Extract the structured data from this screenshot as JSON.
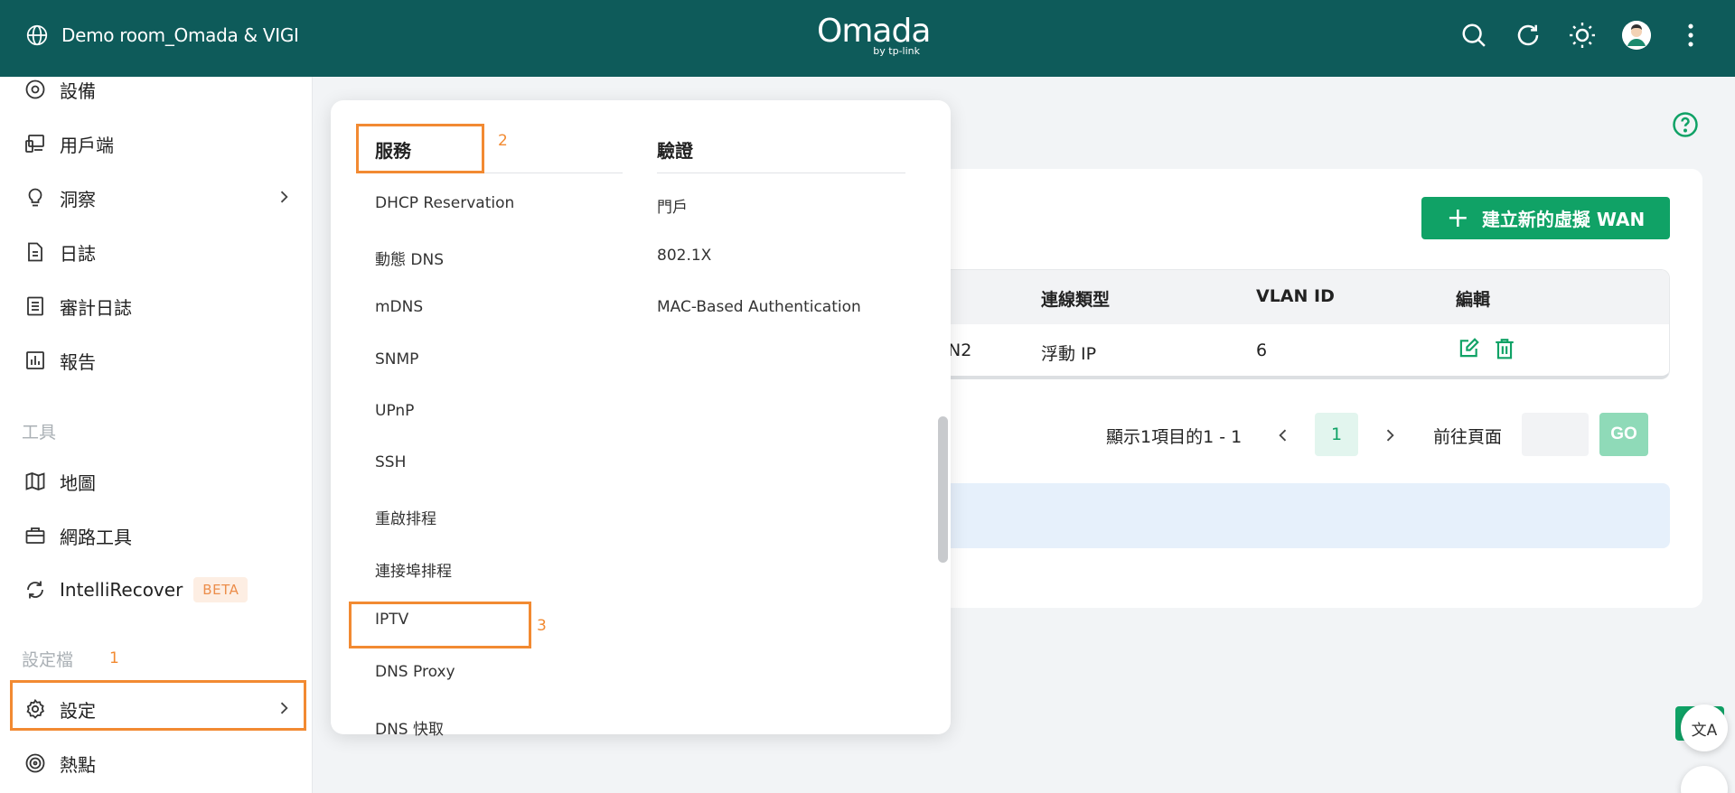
{
  "header": {
    "site_name": "Demo room_Omada & VIGI",
    "brand": "Omada",
    "brand_sub": "by tp-link",
    "icons": [
      "search-icon",
      "refresh-icon",
      "theme-icon",
      "avatar",
      "more-icon"
    ]
  },
  "sidebar": {
    "items": [
      {
        "label": "設備",
        "icon": "devices-icon"
      },
      {
        "label": "用戶端",
        "icon": "clients-icon"
      },
      {
        "label": "洞察",
        "icon": "insight-icon"
      },
      {
        "label": "日誌",
        "icon": "log-icon"
      },
      {
        "label": "審計日誌",
        "icon": "audit-log-icon"
      },
      {
        "label": "報告",
        "icon": "report-icon"
      }
    ],
    "tools_section": "工具",
    "tools": [
      {
        "label": "地圖",
        "icon": "map-icon"
      },
      {
        "label": "網路工具",
        "icon": "network-tools-icon"
      },
      {
        "label": "IntelliRecover",
        "icon": "intellirecover-icon",
        "badge": "BETA"
      }
    ],
    "profile_section": "設定檔",
    "profile": [
      {
        "label": "設定",
        "icon": "gear-icon"
      },
      {
        "label": "熱點",
        "icon": "hotspot-icon"
      }
    ]
  },
  "annotations": {
    "a1": "1",
    "a2": "2",
    "a3": "3"
  },
  "menu": {
    "services_title": "服務",
    "services": [
      "DHCP Reservation",
      "動態 DNS",
      "mDNS",
      "SNMP",
      "UPnP",
      "SSH",
      "重啟排程",
      "連接埠排程",
      "IPTV",
      "DNS Proxy",
      "DNS 快取"
    ],
    "auth_title": "驗證",
    "auth": [
      "門戶",
      "802.1X",
      "MAC-Based Authentication"
    ]
  },
  "main": {
    "add_button": "建立新的虛擬 WAN",
    "table": {
      "headers": [
        "連線類型",
        "VLAN ID",
        "編輯"
      ],
      "row": {
        "name_fragment": "N2",
        "type": "浮動 IP",
        "vlan": "6"
      }
    },
    "pager": {
      "summary": "顯示1項目的1 - 1",
      "page": "1",
      "goto_label": "前往頁面",
      "goto_value": "",
      "go": "GO"
    }
  },
  "widgets": {
    "translate": "文A"
  },
  "colors": {
    "header": "#0e5b5a",
    "accent": "#10a266",
    "highlight": "#f28a32"
  }
}
